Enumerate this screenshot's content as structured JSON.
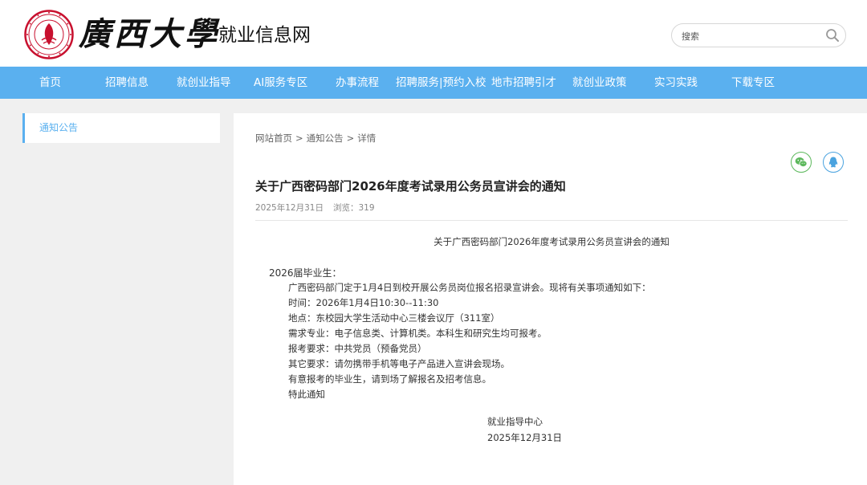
{
  "header": {
    "brand": "廣西大學",
    "site_title": "就业信息网",
    "search": {
      "placeholder": "搜索",
      "value": ""
    }
  },
  "nav": {
    "items": [
      {
        "label": "首页"
      },
      {
        "label": "招聘信息"
      },
      {
        "label": "就创业指导"
      },
      {
        "label": "AI服务专区"
      },
      {
        "label": "办事流程"
      },
      {
        "label": "招聘服务|预约入校"
      },
      {
        "label": "地市招聘引才"
      },
      {
        "label": "就创业政策"
      },
      {
        "label": "实习实践"
      },
      {
        "label": "下载专区"
      }
    ]
  },
  "sidebar": {
    "items": [
      {
        "label": "通知公告",
        "active": true
      }
    ]
  },
  "breadcrumb": {
    "items": [
      "网站首页",
      "通知公告",
      "详情"
    ],
    "separator": ">"
  },
  "share": {
    "icons": [
      "wechat-icon",
      "qq-icon"
    ]
  },
  "article": {
    "title": "关于广西密码部门2026年度考试录用公务员宣讲会的通知",
    "date": "2025年12月31日",
    "views_label": "浏览：",
    "views": "319",
    "doc_heading": "关于广西密码部门2026年度考试录用公务员宣讲会的通知",
    "greeting": "2026届毕业生：",
    "lines": [
      "广西密码部门定于1月4日到校开展公务员岗位报名招录宣讲会。现将有关事项通知如下：",
      "时间：2026年1月4日10:30--11:30",
      "地点：东校园大学生活动中心三楼会议厅（311室）",
      "需求专业：电子信息类、计算机类。本科生和研究生均可报考。",
      "报考要求：中共党员（预备党员）",
      "其它要求：请勿携带手机等电子产品进入宣讲会现场。",
      "有意报考的毕业生，请到场了解报名及招考信息。",
      "特此通知"
    ],
    "signature": {
      "org": "就业指导中心",
      "date": "2025年12月31日"
    }
  },
  "colors": {
    "nav_bg": "#5ab0ef",
    "accent": "#5ab0ef",
    "seal_red": "#c8102e",
    "wechat_green": "#5cb85c",
    "qq_blue": "#4aa3df"
  }
}
